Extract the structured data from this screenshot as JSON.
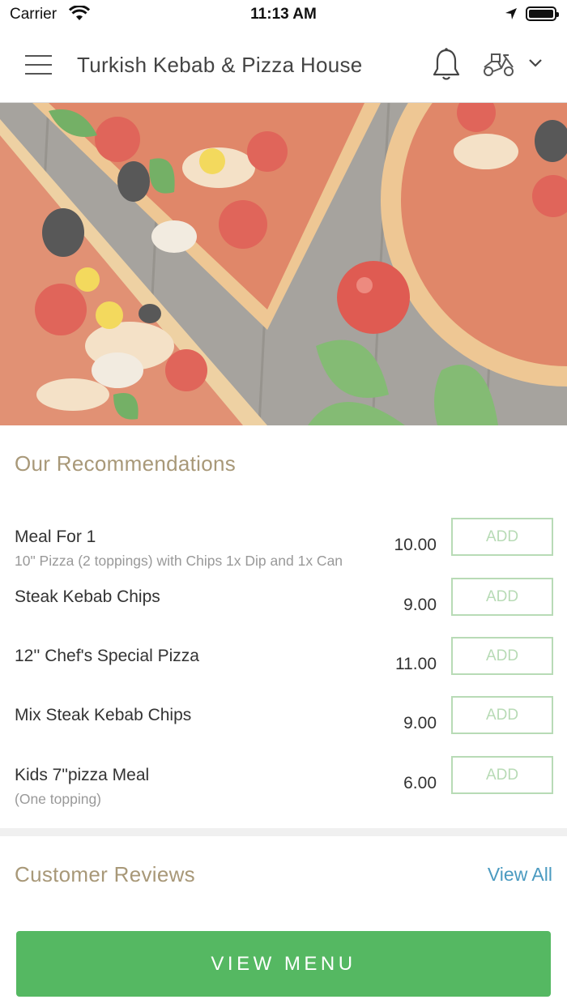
{
  "status_bar": {
    "carrier": "Carrier",
    "time": "11:13 AM"
  },
  "header": {
    "title": "Turkish Kebab & Pizza House"
  },
  "recommendations": {
    "title": "Our Recommendations",
    "items": [
      {
        "name": "Meal For 1",
        "description": "10\" Pizza (2 toppings) with Chips 1x Dip and 1x Can",
        "price": "10.00",
        "add_label": "ADD"
      },
      {
        "name": "Steak Kebab Chips",
        "description": "",
        "price": "9.00",
        "add_label": "ADD"
      },
      {
        "name": "12'' Chef's Special Pizza",
        "description": "",
        "price": "11.00",
        "add_label": "ADD"
      },
      {
        "name": "Mix Steak Kebab Chips",
        "description": "",
        "price": "9.00",
        "add_label": "ADD"
      },
      {
        "name": "Kids 7\"pizza Meal",
        "description": "(One topping)",
        "price": "6.00",
        "add_label": "ADD"
      }
    ]
  },
  "reviews": {
    "title": "Customer Reviews",
    "view_all": "View All"
  },
  "cta": {
    "label": "VIEW MENU"
  },
  "colors": {
    "accent_green": "#55b862",
    "add_outline": "#b8dbb6",
    "section_title": "#a89878",
    "link": "#4a9ac0"
  }
}
